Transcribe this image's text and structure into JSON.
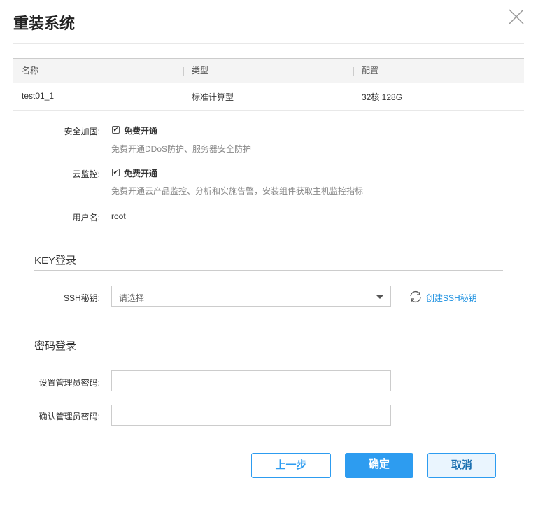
{
  "dialog": {
    "title": "重装系统"
  },
  "table": {
    "headers": [
      "名称",
      "类型",
      "配置"
    ],
    "rows": [
      [
        "test01_1",
        "标准计算型",
        "32核 128G"
      ]
    ]
  },
  "security": {
    "label": "安全加固:",
    "checkbox": "免费开通",
    "hint": "免费开通DDoS防护、服务器安全防护",
    "checked": true
  },
  "monitor": {
    "label": "云监控:",
    "checkbox": "免费开通",
    "hint": "免费开通云产品监控、分析和实施告警，安装组件获取主机监控指标",
    "checked": true
  },
  "username": {
    "label": "用户名:",
    "value": "root"
  },
  "key_section": {
    "title": "KEY登录",
    "ssh_label": "SSH秘钥:",
    "ssh_placeholder": "请选择",
    "create_link": "创建SSH秘钥"
  },
  "password_section": {
    "title": "密码登录",
    "set_label": "设置管理员密码:",
    "confirm_label": "确认管理员密码:"
  },
  "buttons": {
    "prev": "上一步",
    "ok": "确定",
    "cancel": "取消"
  },
  "colors": {
    "primary": "#2d9cf0",
    "link": "#1a8fe0"
  }
}
